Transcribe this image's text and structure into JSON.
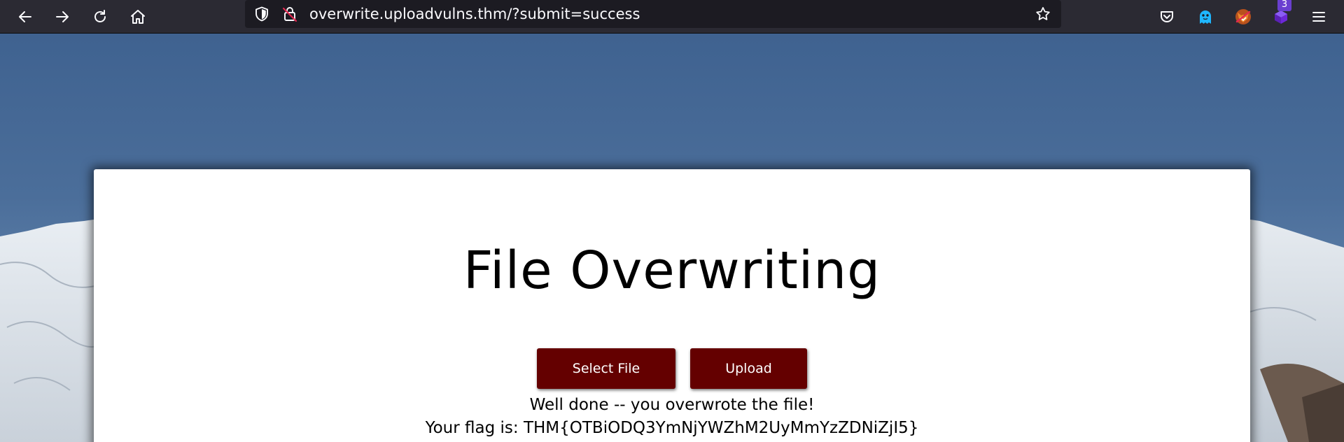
{
  "browser": {
    "url": "overwrite.uploadvulns.thm/?submit=success",
    "extension_badge": "3",
    "icons": {
      "back": "arrow-left-icon",
      "forward": "arrow-right-icon",
      "reload": "reload-icon",
      "home": "home-icon",
      "tracking": "shield-icon",
      "insecure": "insecure-lock-icon",
      "bookmark": "star-icon",
      "pocket": "pocket-icon",
      "ghostery": "ghost-icon",
      "foxyproxy": "fox-icon",
      "extension": "cube-icon",
      "menu": "hamburger-menu-icon"
    },
    "colors": {
      "toolbar": "#2b2a33",
      "urlbar": "#1c1b22",
      "text": "#fbfbfe",
      "badge": "#6a3fd0"
    }
  },
  "page": {
    "title": "File Overwriting",
    "select_button": "Select File",
    "upload_button": "Upload",
    "success_message": "Well done -- you overwrote the file!",
    "flag_message": "Your flag is: THM{OTBiODQ3YmNjYWZhM2UyMmYzZDNiZjI5}",
    "colors": {
      "button": "#640000",
      "card": "#ffffff",
      "sky": "#4b6e9a"
    }
  }
}
